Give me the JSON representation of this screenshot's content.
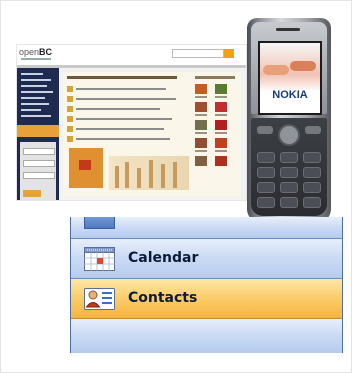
{
  "website": {
    "logo_main": "open",
    "logo_bc": "BC"
  },
  "phone": {
    "brand": "NOKIA"
  },
  "navigation_pane": {
    "items": [
      {
        "label": "Calendar",
        "icon": "calendar-icon",
        "selected": false
      },
      {
        "label": "Contacts",
        "icon": "contacts-icon",
        "selected": true
      }
    ]
  },
  "colors": {
    "nav_blue": "#cddcf5",
    "nav_selected_orange": "#fbcf6e",
    "nav_border": "#4d6fa8"
  }
}
